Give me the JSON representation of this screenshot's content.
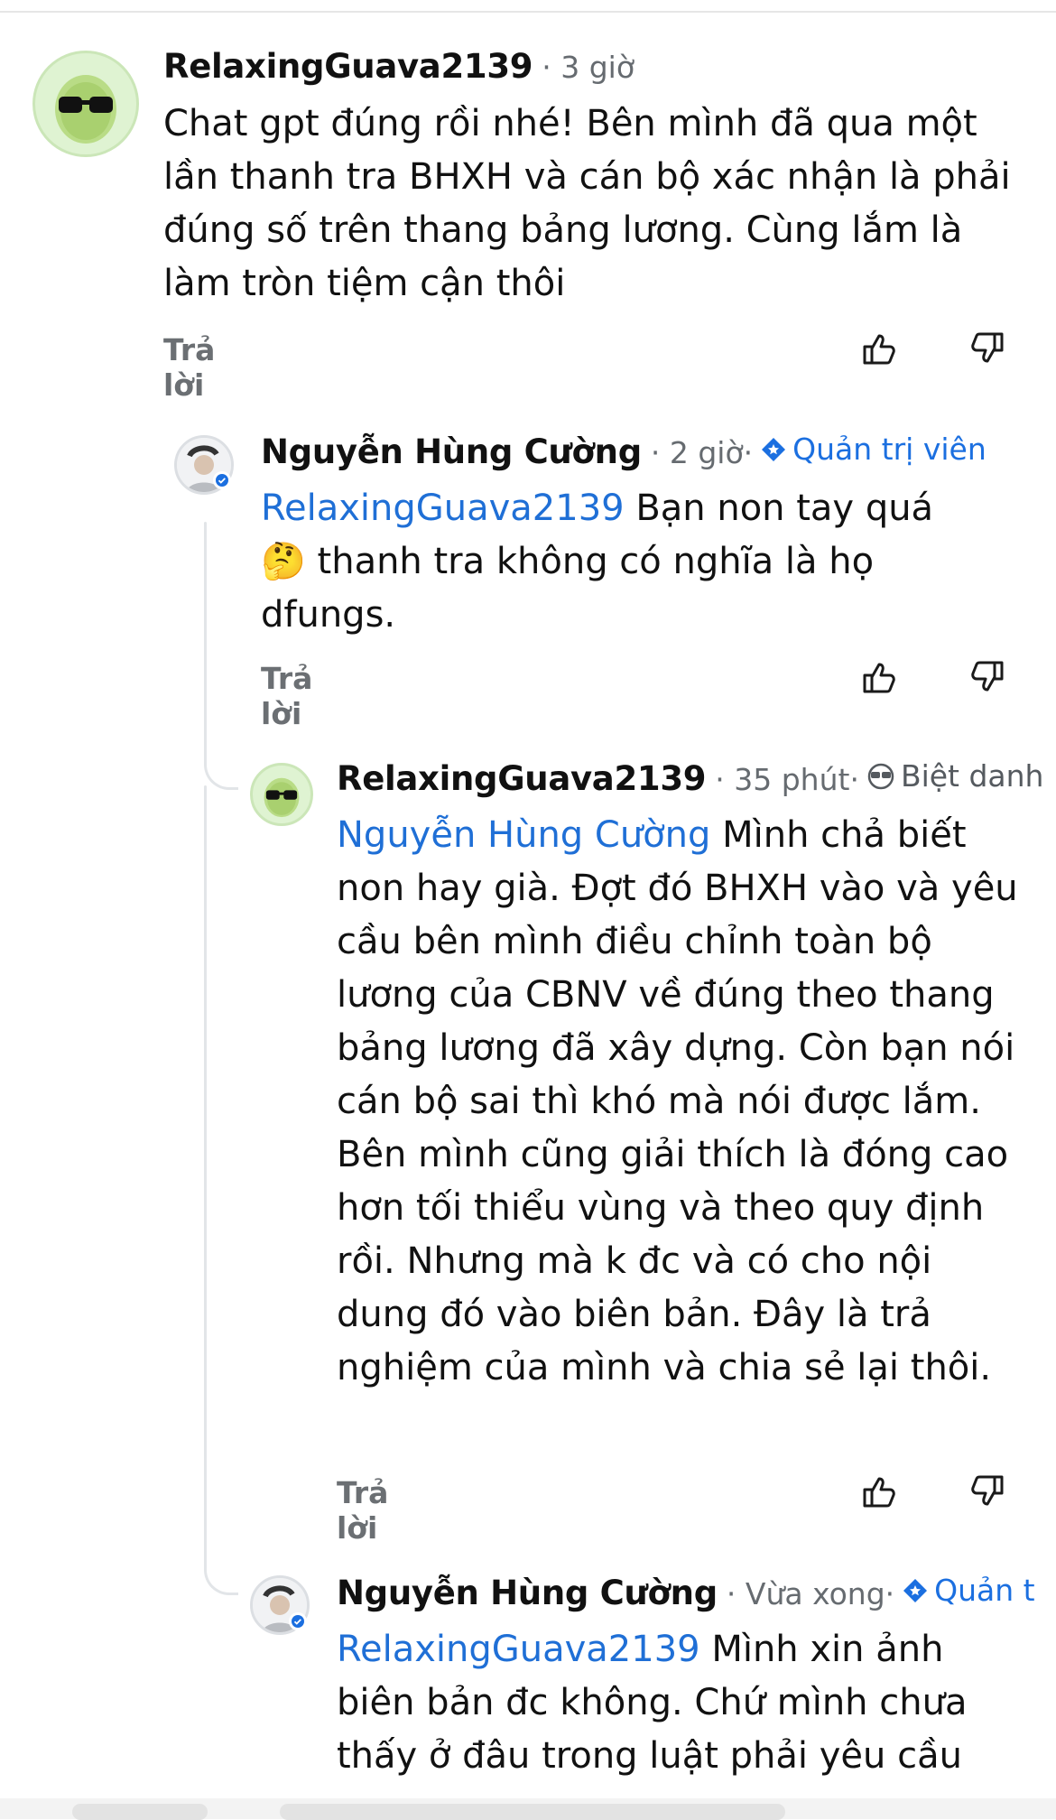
{
  "comments": [
    {
      "author": "RelaxingGuava2139",
      "time": "· 3 giờ",
      "role": "",
      "mention": "",
      "text": "Chat gpt đúng rồi nhé! Bên mình đã qua một lần thanh tra BHXH và cán bộ xác nhận là phải đúng số trên thang bảng lương. Cùng lắm là làm tròn tiệm cận thôi",
      "reply": "Trả lời",
      "avatar_icon": "guava-sunglasses-icon"
    },
    {
      "author": "Nguyễn Hùng Cường",
      "time": "· 2 giờ·",
      "role": "Quản trị viên",
      "role_icon": "moderator-shield-icon",
      "mention": "RelaxingGuava2139",
      "text_line1": " Bạn non tay quá",
      "emoji": "🤔",
      "text_rest": " thanh tra không có nghĩa là họ dfungs.",
      "reply": "Trả lời",
      "avatar_icon": "user-photo-avatar"
    },
    {
      "author": "RelaxingGuava2139",
      "time": "· 35 phút·",
      "role": "Biệt danh",
      "role_icon": "sunglasses-icon",
      "mention": "Nguyễn Hùng Cường",
      "text": " Mình chả biết non hay già. Đợt đó BHXH vào và yêu cầu bên mình điều chỉnh toàn bộ lương của CBNV về đúng theo thang bảng lương đã xây dựng. Còn bạn nói cán bộ sai thì khó mà nói được lắm. Bên mình cũng giải thích là đóng cao hơn tối thiểu vùng và theo quy định rồi. Nhưng mà k đc và có cho nội dung đó vào biên bản. Đây là trả nghiệm của mình và chia sẻ lại thôi.",
      "reply": "Trả lời",
      "avatar_icon": "guava-sunglasses-icon"
    },
    {
      "author": "Nguyễn Hùng Cường",
      "time": "· Vừa xong·",
      "role": "Quản t",
      "role_icon": "moderator-shield-icon",
      "mention": "RelaxingGuava2139",
      "text": " Mình xin ảnh biên bản đc không. Chứ mình chưa thấy ở đâu trong luật phải yêu cầu",
      "avatar_icon": "user-photo-avatar"
    }
  ],
  "colors": {
    "mention": "#1f6fd6",
    "moderator": "#1b6fe0",
    "meta": "#666b70",
    "thread_line": "#e2e5e8"
  }
}
